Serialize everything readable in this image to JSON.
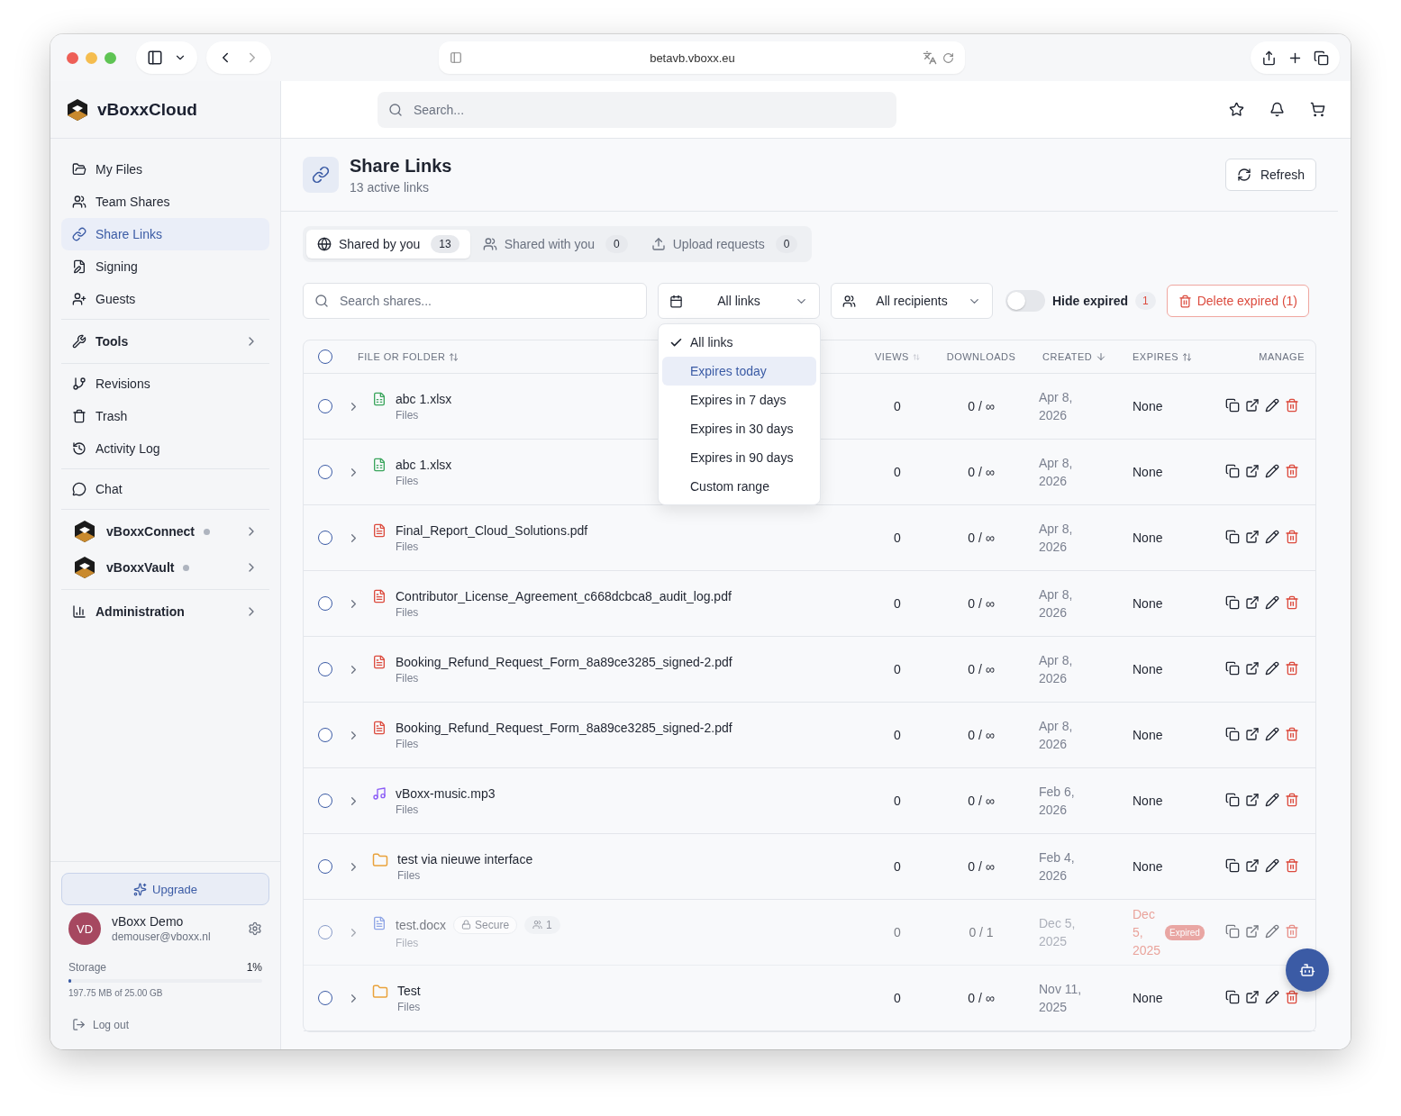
{
  "browser": {
    "url": "betavb.vboxx.eu"
  },
  "app": {
    "brand": "vBoxxCloud",
    "search_placeholder": "Search..."
  },
  "sidebar": {
    "sections": [
      [
        {
          "kind": "link",
          "label": "My Files",
          "selected": false
        },
        {
          "kind": "link",
          "label": "Team Shares",
          "selected": false
        },
        {
          "kind": "link",
          "label": "Share Links",
          "selected": true
        },
        {
          "kind": "link",
          "label": "Signing",
          "selected": false
        },
        {
          "kind": "link",
          "label": "Guests",
          "selected": false
        }
      ],
      [
        {
          "kind": "group",
          "label": "Tools",
          "selected": false
        }
      ],
      [
        {
          "kind": "link",
          "label": "Revisions",
          "selected": false
        },
        {
          "kind": "link",
          "label": "Trash",
          "selected": false
        },
        {
          "kind": "link",
          "label": "Activity Log",
          "selected": false
        }
      ],
      [
        {
          "kind": "link",
          "label": "Chat",
          "selected": false
        }
      ],
      [
        {
          "kind": "app",
          "label": "vBoxxConnect",
          "selected": false
        },
        {
          "kind": "app",
          "label": "vBoxxVault",
          "selected": false
        }
      ],
      [
        {
          "kind": "group",
          "label": "Administration",
          "selected": false
        }
      ]
    ],
    "upgrade": "Upgrade",
    "user": {
      "initials": "VD",
      "name": "vBoxx Demo",
      "email": "demouser@vboxx.nl"
    },
    "storage": {
      "label": "Storage",
      "percent": "1%",
      "level": 0.01,
      "detail": "197.75 MB of 25.00 GB"
    },
    "logout": "Log out"
  },
  "page": {
    "title": "Share Links",
    "subtitle": "13 active links",
    "refresh": "Refresh"
  },
  "tabs": [
    {
      "label": "Shared by you",
      "count": "13",
      "selected": true
    },
    {
      "label": "Shared with you",
      "count": "0",
      "selected": false
    },
    {
      "label": "Upload requests",
      "count": "0",
      "selected": false
    }
  ],
  "filters": {
    "search_placeholder": "Search shares...",
    "period": "All links",
    "recipients": "All recipients",
    "hide_expired": {
      "label": "Hide expired",
      "on": false,
      "count": "1"
    },
    "delete_expired": "Delete expired (1)"
  },
  "period_menu": [
    {
      "label": "All links",
      "selected": true,
      "highlighted": false
    },
    {
      "label": "Expires today",
      "selected": false,
      "highlighted": true
    },
    {
      "label": "Expires in 7 days",
      "selected": false,
      "highlighted": false
    },
    {
      "label": "Expires in 30 days",
      "selected": false,
      "highlighted": false
    },
    {
      "label": "Expires in 90 days",
      "selected": false,
      "highlighted": false
    },
    {
      "label": "Custom range",
      "selected": false,
      "highlighted": false
    }
  ],
  "table": {
    "select_all_checked": false,
    "columns": [
      "FILE OR FOLDER",
      "VIEWS",
      "DOWNLOADS",
      "CREATED",
      "EXPIRES",
      "MANAGE"
    ],
    "rows": [
      {
        "kind": "sheet",
        "name": "abc 1.xlsx",
        "location": "Files",
        "views": "0",
        "downloads": "0 / ∞",
        "created": "Apr 8, 2026",
        "expires": "None",
        "expired": false,
        "checked": false
      },
      {
        "kind": "sheet",
        "name": "abc 1.xlsx",
        "location": "Files",
        "views": "0",
        "downloads": "0 / ∞",
        "created": "Apr 8, 2026",
        "expires": "None",
        "expired": false,
        "checked": false
      },
      {
        "kind": "pdf",
        "name": "Final_Report_Cloud_Solutions.pdf",
        "location": "Files",
        "views": "0",
        "downloads": "0 / ∞",
        "created": "Apr 8, 2026",
        "expires": "None",
        "expired": false,
        "checked": false
      },
      {
        "kind": "pdf",
        "name": "Contributor_License_Agreement_c668dcbca8_audit_log.pdf",
        "location": "Files",
        "views": "0",
        "downloads": "0 / ∞",
        "created": "Apr 8, 2026",
        "expires": "None",
        "expired": false,
        "checked": false
      },
      {
        "kind": "pdf",
        "name": "Booking_Refund_Request_Form_8a89ce3285_signed-2.pdf",
        "location": "Files",
        "views": "0",
        "downloads": "0 / ∞",
        "created": "Apr 8, 2026",
        "expires": "None",
        "expired": false,
        "checked": false
      },
      {
        "kind": "pdf",
        "name": "Booking_Refund_Request_Form_8a89ce3285_signed-2.pdf",
        "location": "Files",
        "views": "0",
        "downloads": "0 / ∞",
        "created": "Apr 8, 2026",
        "expires": "None",
        "expired": false,
        "checked": false
      },
      {
        "kind": "audio",
        "name": "vBoxx-music.mp3",
        "location": "Files",
        "views": "0",
        "downloads": "0 / ∞",
        "created": "Feb 6, 2026",
        "expires": "None",
        "expired": false,
        "checked": false
      },
      {
        "kind": "folder",
        "name": "test via nieuwe interface",
        "location": "Files",
        "views": "0",
        "downloads": "0 / ∞",
        "created": "Feb 4, 2026",
        "expires": "None",
        "expired": false,
        "checked": false
      },
      {
        "kind": "doc",
        "name": "test.docx",
        "location": "Files",
        "tags": [
          {
            "kind": "lock",
            "label": "Secure"
          },
          {
            "kind": "people",
            "label": "1"
          }
        ],
        "views": "0",
        "downloads": "0 / 1",
        "created": "Dec 5, 2025",
        "expires": "Dec 5, 2025",
        "expired": true,
        "expired_label": "Expired",
        "checked": false
      },
      {
        "kind": "folder",
        "name": "Test",
        "location": "Files",
        "views": "0",
        "downloads": "0 / ∞",
        "created": "Nov 11, 2025",
        "expires": "None",
        "expired": false,
        "checked": false
      }
    ]
  }
}
